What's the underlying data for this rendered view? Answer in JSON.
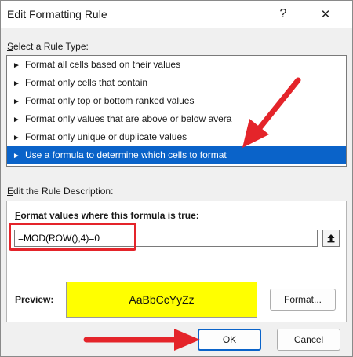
{
  "window": {
    "title": "Edit Formatting Rule",
    "help_glyph": "?",
    "close_glyph": "✕"
  },
  "rule_type": {
    "label": "Select a Rule Type:",
    "bullet": "►",
    "items": [
      {
        "label": "Format all cells based on their values",
        "selected": false
      },
      {
        "label": "Format only cells that contain",
        "selected": false
      },
      {
        "label": "Format only top or bottom ranked values",
        "selected": false
      },
      {
        "label": "Format only values that are above or below avera",
        "selected": false
      },
      {
        "label": "Format only unique or duplicate values",
        "selected": false
      },
      {
        "label": "Use a formula to determine which cells to format",
        "selected": true
      }
    ]
  },
  "description": {
    "label": "Edit the Rule Description:",
    "heading": "Format values where this formula is true:",
    "formula_value": "=MOD(ROW(),4)=0",
    "preview_label": "Preview:",
    "preview_text": "AaBbCcYyZz",
    "preview_fill": "#ffff00",
    "format_button": "Format..."
  },
  "buttons": {
    "ok": "OK",
    "cancel": "Cancel"
  },
  "annotations": {
    "color": "#e4242a"
  }
}
